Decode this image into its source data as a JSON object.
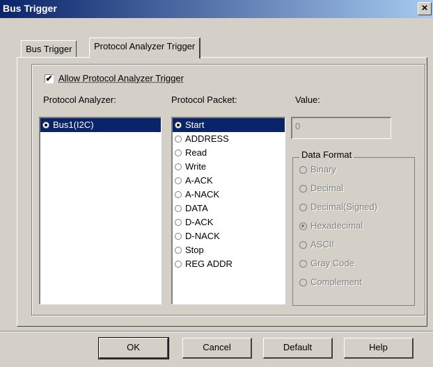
{
  "window": {
    "title": "Bus Trigger",
    "close_glyph": "×"
  },
  "tabs": [
    {
      "label": "Bus Trigger",
      "active": false
    },
    {
      "label": "Protocol Analyzer Trigger",
      "active": true
    }
  ],
  "allow_checkbox": {
    "label": "Allow Protocol Analyzer Trigger",
    "checked": true,
    "check_glyph": "✔"
  },
  "labels": {
    "protocol_analyzer": "Protocol Analyzer:",
    "protocol_packet": "Protocol Packet:",
    "value": "Value:"
  },
  "analyzers": [
    {
      "label": "Bus1(I2C)",
      "selected": true
    }
  ],
  "packets": [
    {
      "label": "Start",
      "selected": true
    },
    {
      "label": "ADDRESS",
      "selected": false
    },
    {
      "label": "Read",
      "selected": false
    },
    {
      "label": "Write",
      "selected": false
    },
    {
      "label": "A-ACK",
      "selected": false
    },
    {
      "label": "A-NACK",
      "selected": false
    },
    {
      "label": "DATA",
      "selected": false
    },
    {
      "label": "D-ACK",
      "selected": false
    },
    {
      "label": "D-NACK",
      "selected": false
    },
    {
      "label": "Stop",
      "selected": false
    },
    {
      "label": "REG ADDR",
      "selected": false
    }
  ],
  "value_field": {
    "value": "0"
  },
  "data_format": {
    "legend": "Data Format",
    "options": [
      {
        "label": "Binary",
        "checked": false
      },
      {
        "label": "Decimal",
        "checked": false
      },
      {
        "label": "Decimal(Signed)",
        "checked": false
      },
      {
        "label": "Hexadecimal",
        "checked": true
      },
      {
        "label": "ASCII",
        "checked": false
      },
      {
        "label": "Gray Code",
        "checked": false
      },
      {
        "label": "Complement",
        "checked": false
      }
    ]
  },
  "buttons": {
    "ok": "OK",
    "cancel": "Cancel",
    "default": "Default",
    "help": "Help"
  },
  "colors": {
    "selection": "#0a246a",
    "face": "#d4d0c8",
    "disabled_text": "#808080"
  }
}
